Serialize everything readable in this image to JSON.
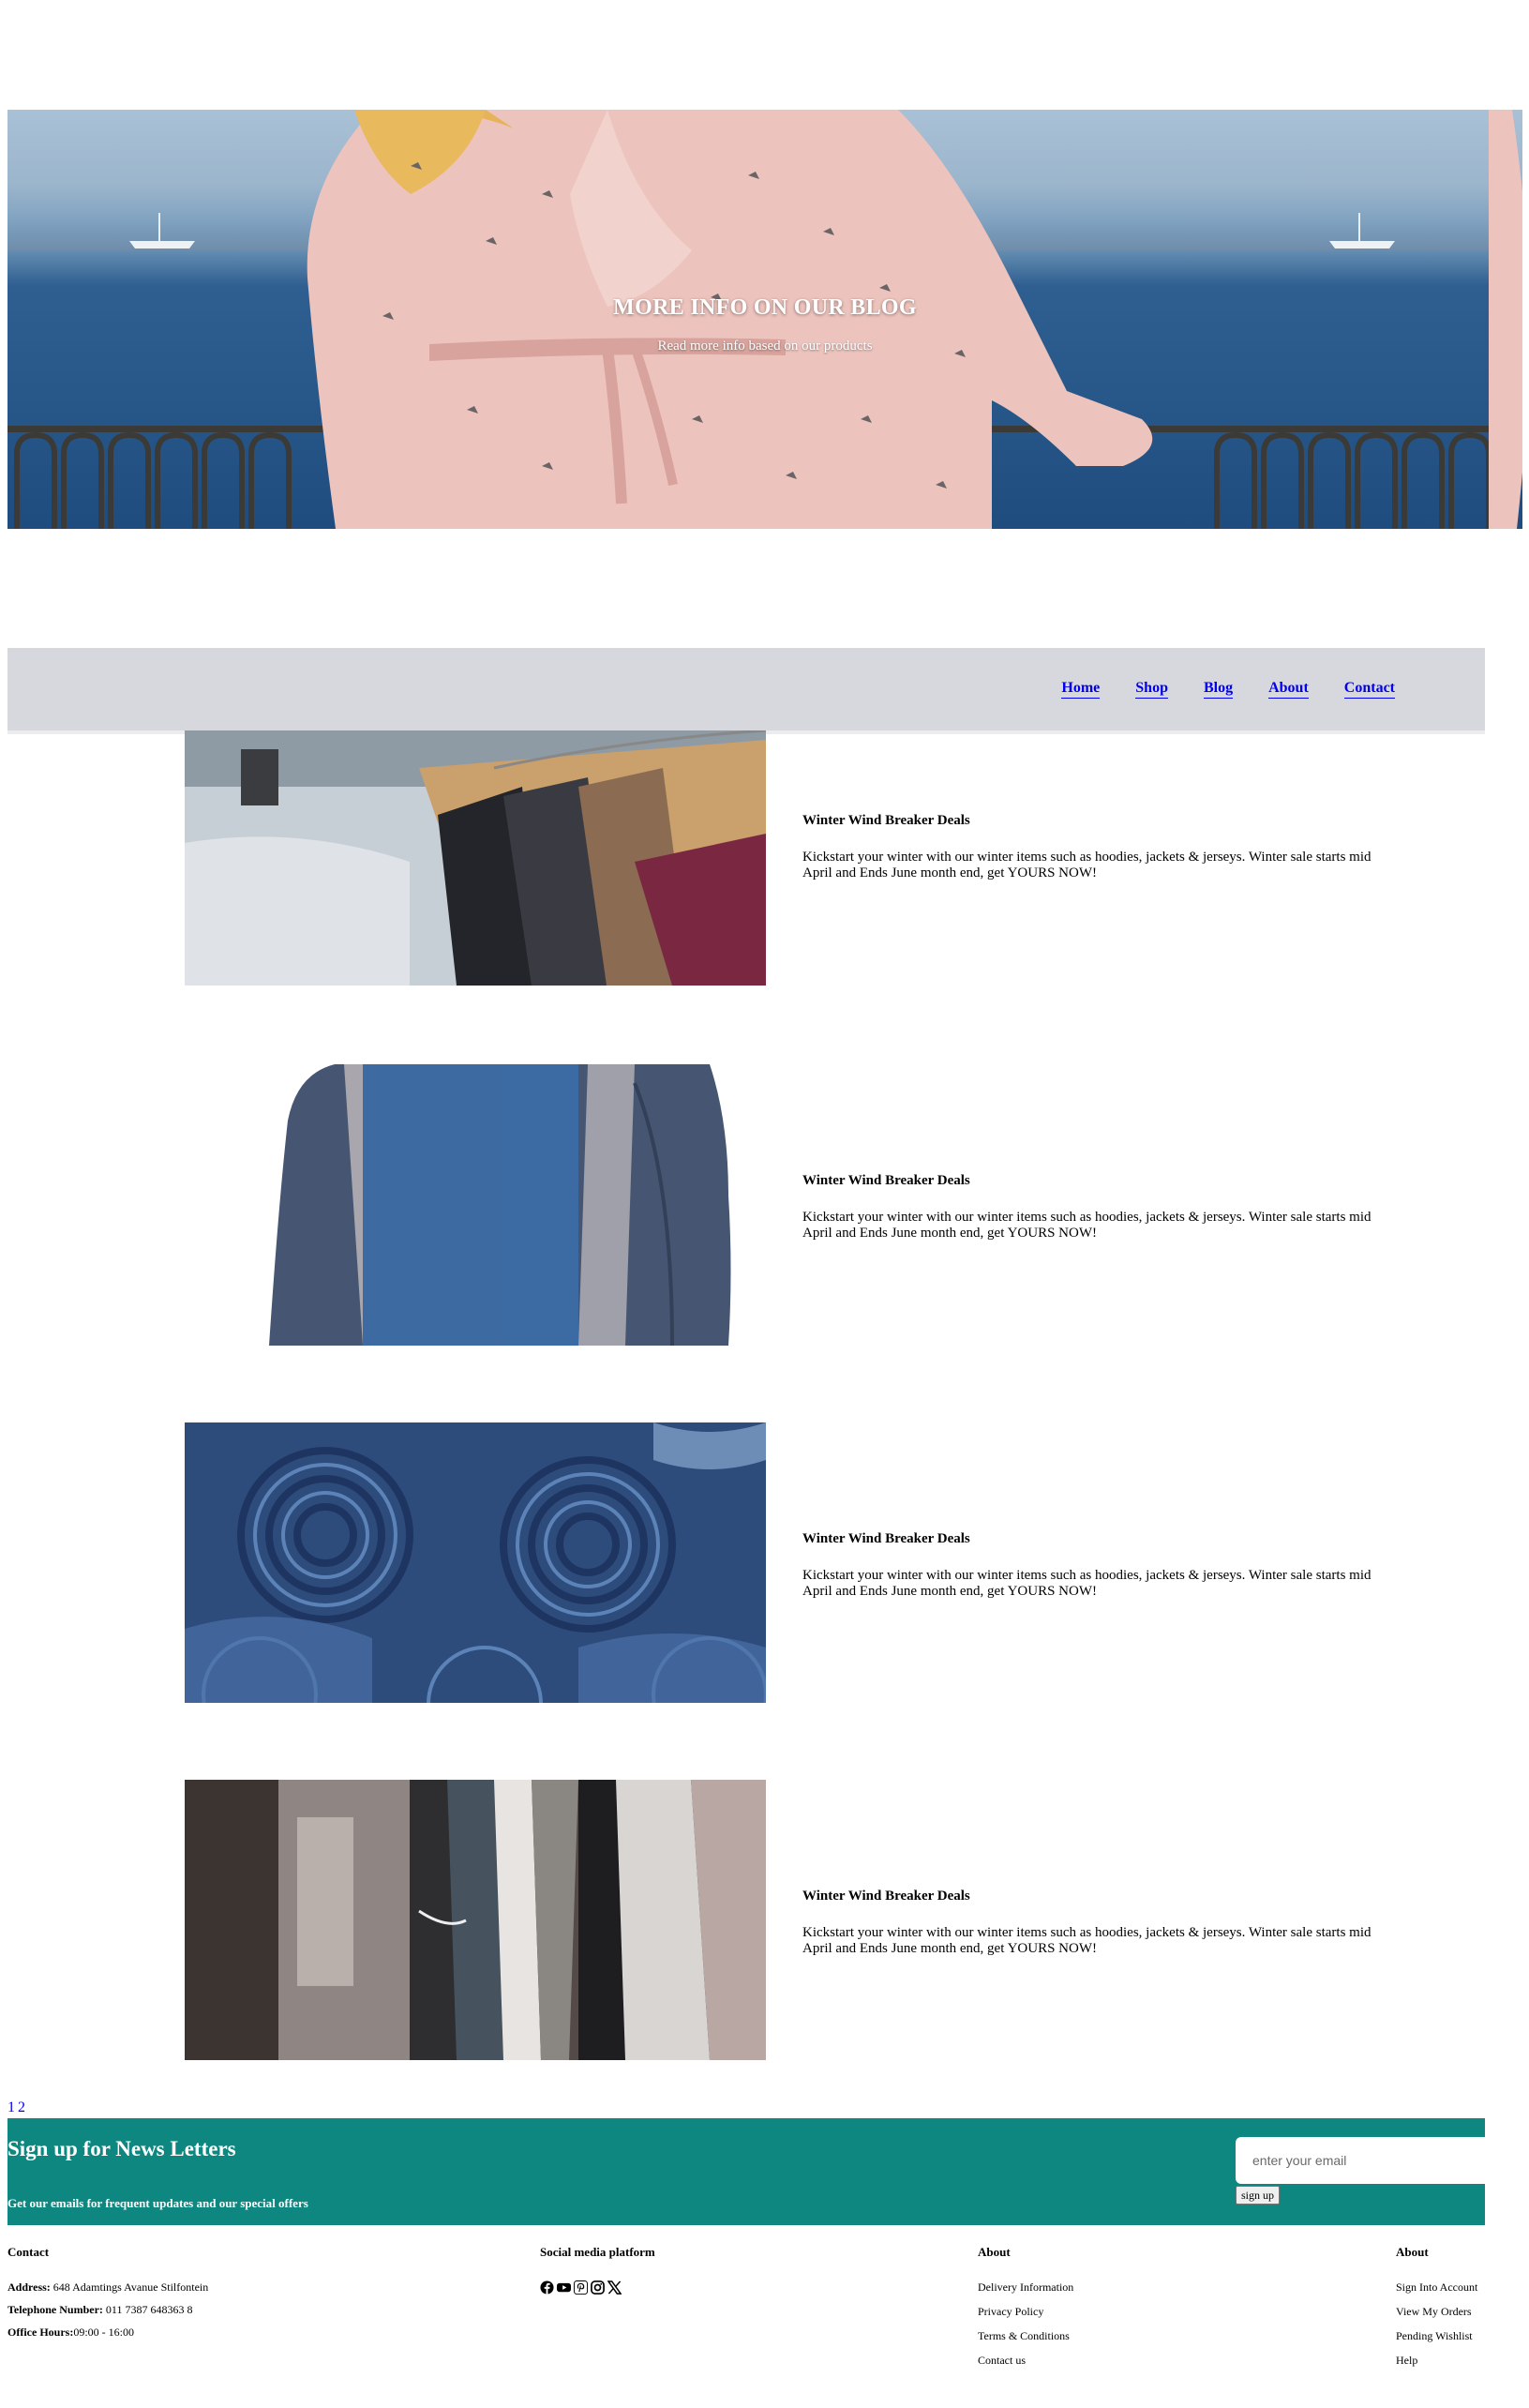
{
  "hero": {
    "title": "MORE INFO ON OUR BLOG",
    "subtitle": "Read more info based on our products"
  },
  "nav": {
    "items": [
      {
        "label": "Home"
      },
      {
        "label": "Shop"
      },
      {
        "label": "Blog"
      },
      {
        "label": "About"
      },
      {
        "label": "Contact"
      }
    ]
  },
  "posts": [
    {
      "image": "clothes-rack-hangers",
      "title": "Winter Wind Breaker Deals",
      "body": "Kickstart your winter with our winter items such as hoodies, jackets & jerseys. Winter sale starts mid April and Ends June month end, get YOURS NOW!"
    },
    {
      "image": "navy-windbreaker-jacket",
      "title": "Winter Wind Breaker Deals",
      "body": "Kickstart your winter with our winter items such as hoodies, jackets & jerseys. Winter sale starts mid April and Ends June month end, get YOURS NOW!"
    },
    {
      "image": "rolled-denim-jeans",
      "title": "Winter Wind Breaker Deals",
      "body": "Kickstart your winter with our winter items such as hoodies, jackets & jerseys. Winter sale starts mid April and Ends June month end, get YOURS NOW!"
    },
    {
      "image": "clothing-store-rack",
      "title": "Winter Wind Breaker Deals",
      "body": "Kickstart your winter with our winter items such as hoodies, jackets & jerseys. Winter sale starts mid April and Ends June month end, get YOURS NOW!"
    }
  ],
  "pagination": [
    "1",
    "2"
  ],
  "newsletter": {
    "title": "Sign up for News Letters",
    "subtitle": "Get our emails for frequent updates and our special offers",
    "input_placeholder": "enter your email",
    "button_label": "sign up",
    "bg_color": "#0d8780"
  },
  "footer": {
    "contact": {
      "heading": "Contact",
      "address_label": "Address:",
      "address": " 648 Adamtings Avanue Stilfontein",
      "phone_label": "Telephone Number:",
      "phone": " 011 7387 648363 8",
      "hours_label": "Office Hours:",
      "hours": "09:00 - 16:00"
    },
    "social": {
      "heading": "Social media platform",
      "icons": [
        "facebook-icon",
        "youtube-icon",
        "pinterest-icon",
        "instagram-icon",
        "x-icon"
      ]
    },
    "about1": {
      "heading": "About",
      "links": [
        "Delivery Information",
        "Privacy Policy",
        "Terms & Conditions",
        "Contact us"
      ]
    },
    "about2": {
      "heading": "About",
      "links": [
        "Sign Into Account",
        "View My Orders",
        "Pending Wishlist",
        "Help"
      ]
    }
  }
}
